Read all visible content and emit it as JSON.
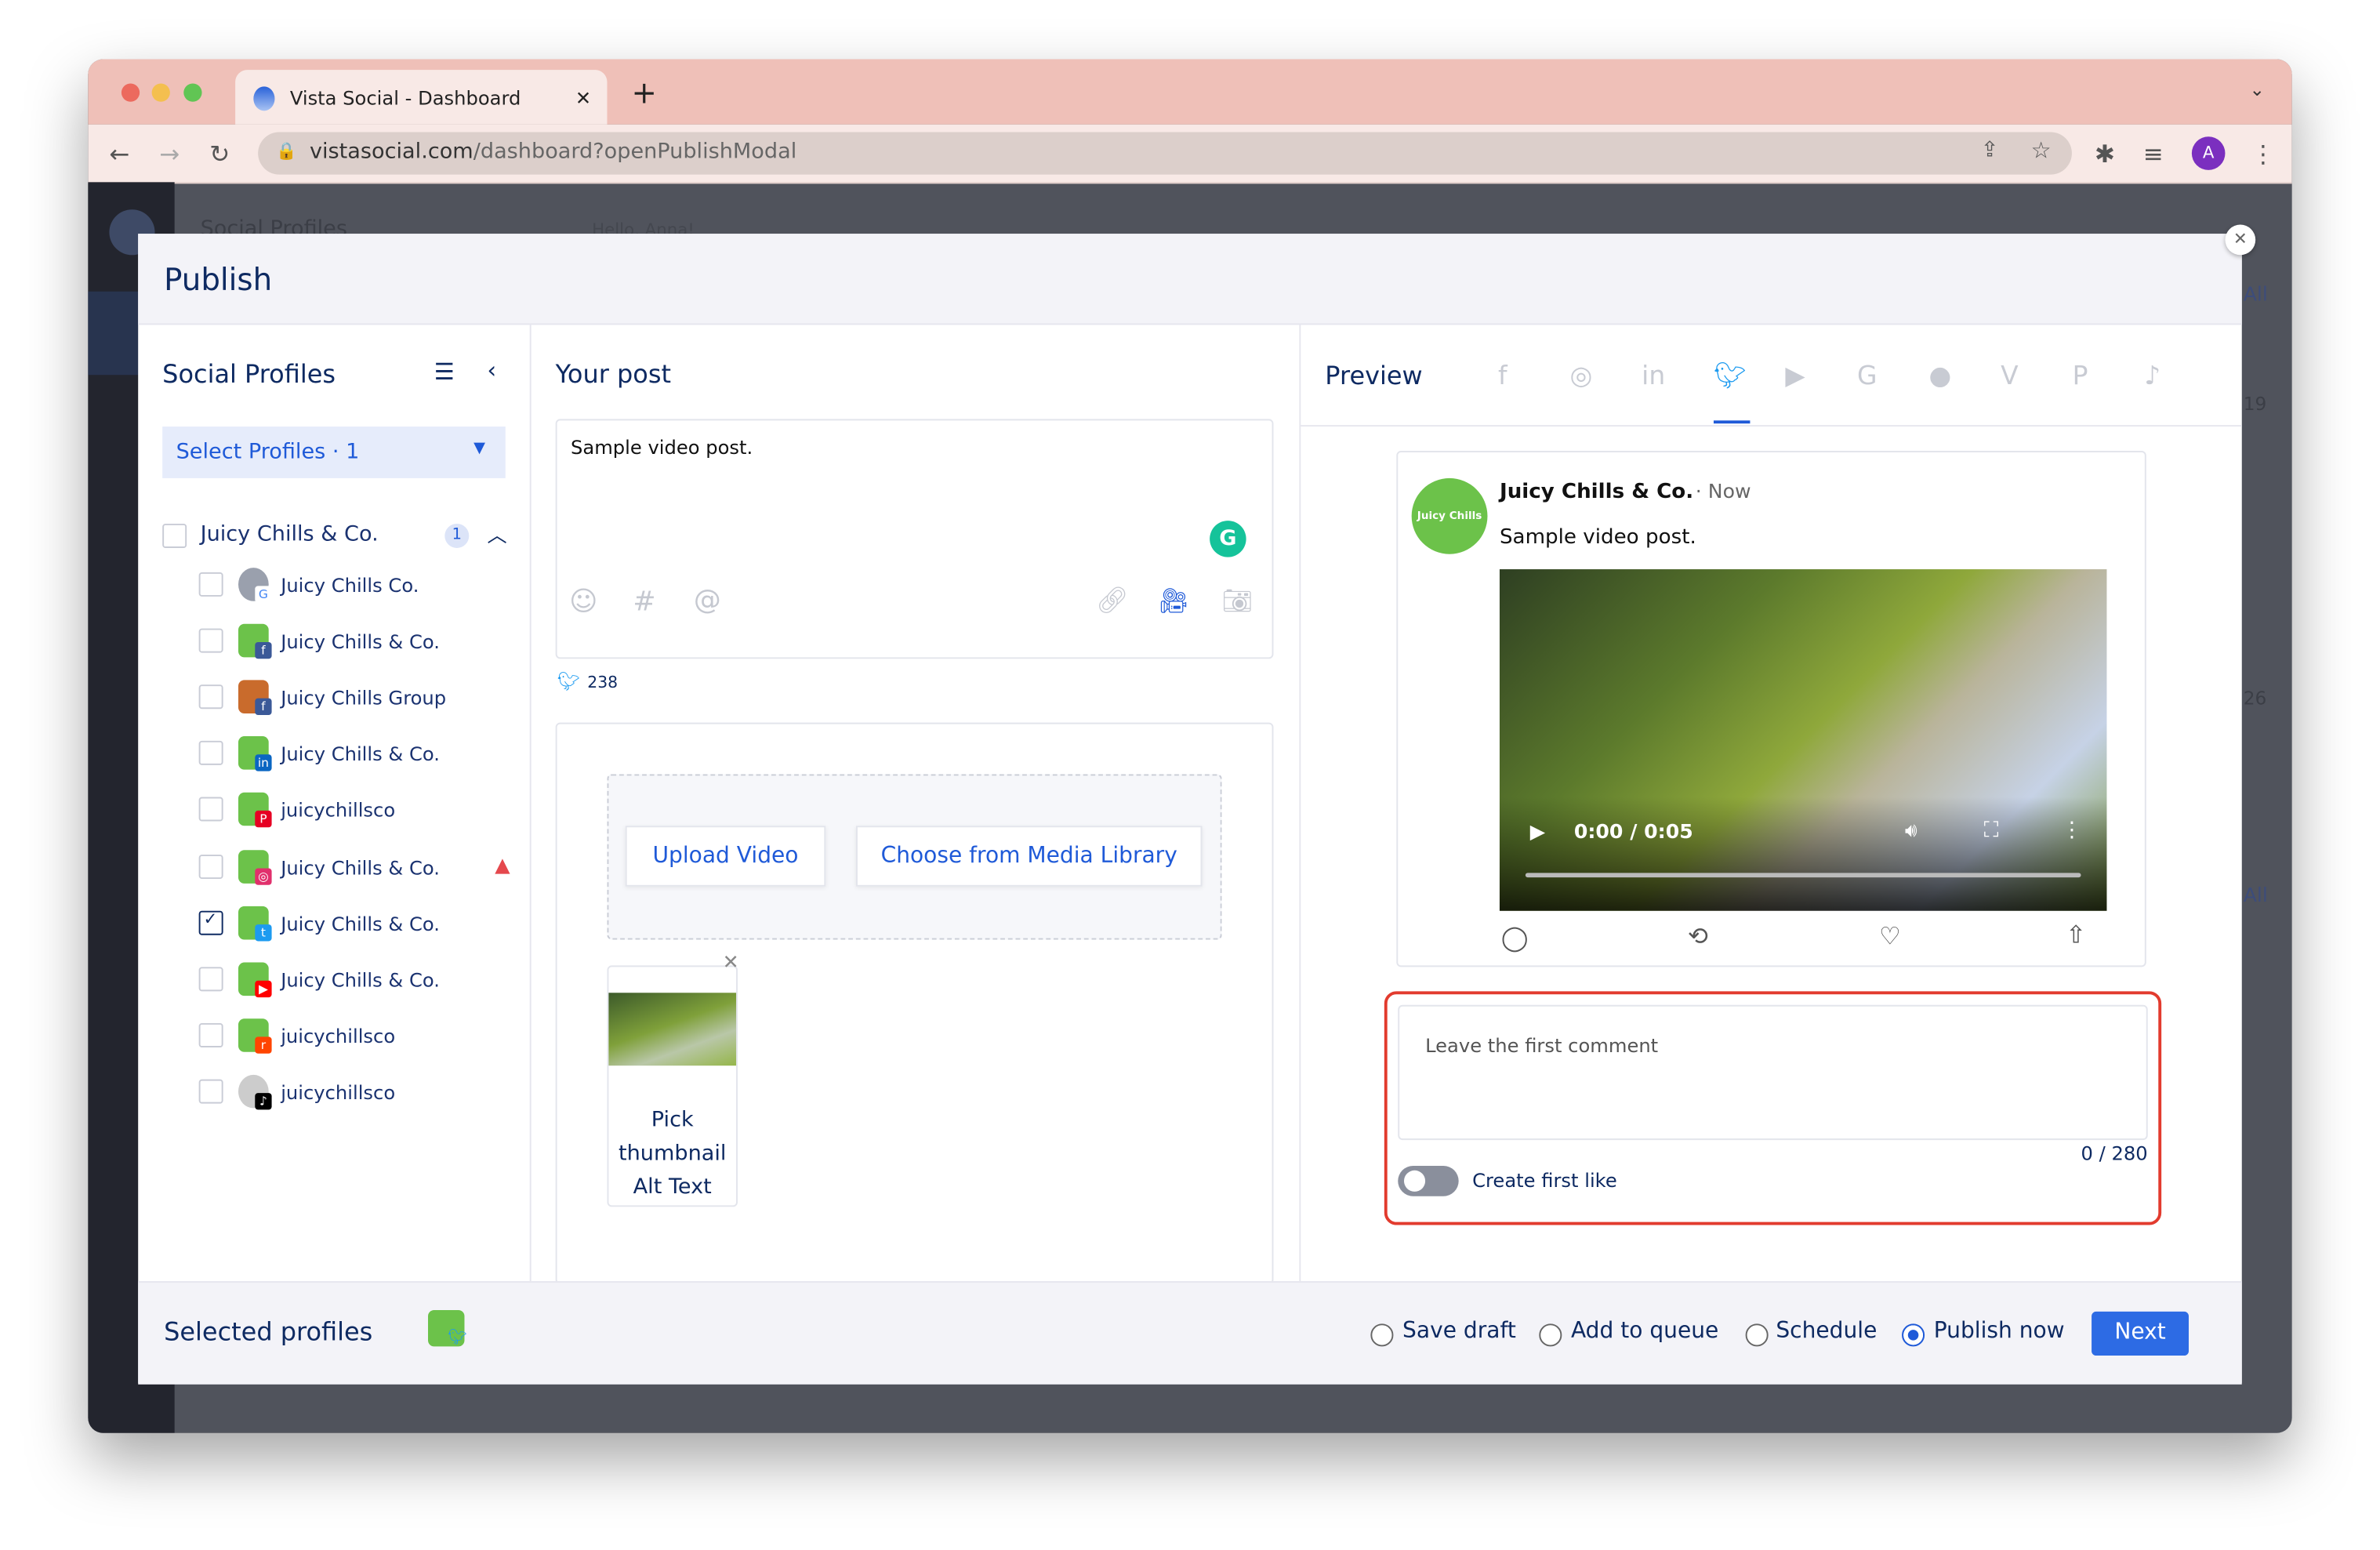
{
  "browser": {
    "tab_title": "Vista Social - Dashboard",
    "tab_close": "✕",
    "new_tab": "+",
    "url_domain": "vistasocial.com",
    "url_path": "/dashboard?openPublishModal",
    "profile_initial": "A"
  },
  "background": {
    "header_title": "Social Profiles",
    "greeting": "Hello, Anna!",
    "right_all_1": "All",
    "right_all_2": "All",
    "right_num_1": "19",
    "right_num_2": "26"
  },
  "modal": {
    "title": "Publish",
    "close": "✕",
    "profiles": {
      "title": "Social Profiles",
      "select_label": "Select Profiles · 1",
      "group": {
        "name": "Juicy Chills & Co.",
        "count": "1"
      },
      "items": [
        {
          "name": "Juicy Chills Co.",
          "network": "google",
          "checked": false,
          "warning": false
        },
        {
          "name": "Juicy Chills & Co.",
          "network": "facebook",
          "checked": false,
          "warning": false
        },
        {
          "name": "Juicy Chills Group",
          "network": "facebook",
          "checked": false,
          "warning": false
        },
        {
          "name": "Juicy Chills & Co.",
          "network": "linkedin",
          "checked": false,
          "warning": false
        },
        {
          "name": "juicychillsco",
          "network": "pinterest",
          "checked": false,
          "warning": false
        },
        {
          "name": "Juicy Chills & Co.",
          "network": "instagram",
          "checked": false,
          "warning": true
        },
        {
          "name": "Juicy Chills & Co.",
          "network": "twitter",
          "checked": true,
          "warning": false
        },
        {
          "name": "Juicy Chills & Co.",
          "network": "youtube",
          "checked": false,
          "warning": false
        },
        {
          "name": "juicychillsco",
          "network": "reddit",
          "checked": false,
          "warning": false
        },
        {
          "name": "juicychillsco",
          "network": "tiktok",
          "checked": false,
          "warning": false
        }
      ]
    },
    "post": {
      "title": "Your post",
      "text": "Sample video post.",
      "char_remaining": "238",
      "upload_video": "Upload Video",
      "choose_library": "Choose from Media Library",
      "thumb_action_1": "Pick",
      "thumb_action_2": "thumbnail",
      "thumb_action_3": "Alt Text"
    },
    "preview": {
      "title": "Preview",
      "networks": [
        "facebook",
        "instagram",
        "linkedin",
        "twitter",
        "youtube",
        "google",
        "reddit",
        "vimeo",
        "pinterest",
        "tiktok"
      ],
      "active_network": "twitter",
      "author": "Juicy Chills & Co.",
      "time": "· Now",
      "text": "Sample video post.",
      "video_time": "0:00 / 0:05",
      "avatar_text": "Juicy Chills",
      "comment_placeholder": "Leave the first comment",
      "comment_count": "0 / 280",
      "first_like_label": "Create first like",
      "first_like_on": false
    },
    "footer": {
      "selected_label": "Selected profiles",
      "options": [
        "Save draft",
        "Add to queue",
        "Schedule",
        "Publish now"
      ],
      "selected_option": "Publish now",
      "next": "Next"
    }
  },
  "colors": {
    "accent": "#1f5ad8",
    "navy": "#0e2a62",
    "twitter": "#1d9bf0",
    "highlight": "#e23b2e",
    "tabbar": "#efc0b8"
  }
}
